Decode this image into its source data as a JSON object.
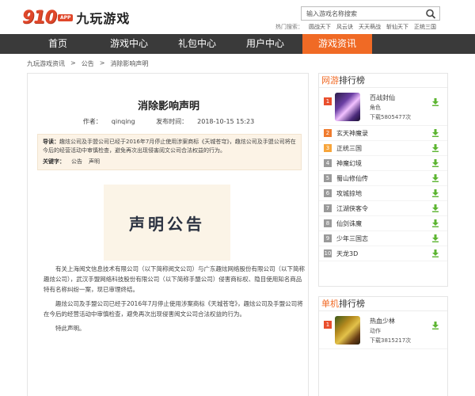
{
  "header": {
    "logo_number": "910",
    "logo_app": "APP",
    "logo_name": "九玩游戏",
    "search_placeholder": "输入游戏名称搜索",
    "hot_label": "热门搜索：",
    "hot_searches": [
      "圆战天下",
      "风云诀",
      "天天萌战",
      "斩仙天下",
      "正统三国"
    ]
  },
  "nav": {
    "items": [
      {
        "label": "首页"
      },
      {
        "label": "游戏中心"
      },
      {
        "label": "礼包中心"
      },
      {
        "label": "用户中心"
      },
      {
        "label": "游戏资讯"
      }
    ],
    "active_index": 4
  },
  "breadcrumb": [
    "九玩游戏资讯",
    ">",
    "公告",
    ">",
    "消除影响声明"
  ],
  "article": {
    "title": "消除影响声明",
    "author_label": "作者：",
    "author": "qinqing",
    "date_label": "发布时间：",
    "date": "2018-10-15 15:23",
    "summary_label": "导读：",
    "summary": "趣炫公司及手盟公司已经于2016年7月停止使用涉案商标《天城苍穹》，趣炫公司及手盟公司将在今后的经营活动中审慎检查，避免再次出现侵害阅文公司合法权益的行为。",
    "keywords_label": "关键字：",
    "keywords": [
      "公告",
      "声明"
    ],
    "stamp_text": "声明公告",
    "paragraphs": [
      "有关上海阅文信息技术有限公司（以下简称阅文公司）与广东趣炫网络股份有限公司（以下简称趣炫公司），武汉手盟网络科技股份有限公司（以下简称手盟公司）侵害商标权、隐目使用知名商品特有名称纠纷一案，现已审理终结。",
      "趣炫公司及手盟公司已经于2016年7月停止使用涉案商标《天城苍穹》，趣炫公司及手盟公司将在今后的经营活动中审慎检查，避免再次出现侵害阅文公司合法权益的行为。",
      "特此声明。"
    ]
  },
  "sidebar": {
    "online": {
      "title_a": "网游",
      "title_b": "排行榜",
      "featured": {
        "rank": "1",
        "name": "百战封仙",
        "genre": "角色",
        "downloads": "下载5805477次"
      },
      "items": [
        {
          "rank": "2",
          "name": "玄天神魔录"
        },
        {
          "rank": "3",
          "name": "正统三国"
        },
        {
          "rank": "4",
          "name": "神魔幻境"
        },
        {
          "rank": "5",
          "name": "蜀山修仙传"
        },
        {
          "rank": "6",
          "name": "攻城掠地"
        },
        {
          "rank": "7",
          "name": "江湖侠客令"
        },
        {
          "rank": "8",
          "name": "仙剑诛魔"
        },
        {
          "rank": "9",
          "name": "少年三国志"
        },
        {
          "rank": "10",
          "name": "天龙3D"
        }
      ]
    },
    "single": {
      "title_a": "单机",
      "title_b": "排行榜",
      "featured": {
        "rank": "1",
        "name": "热血少林",
        "genre": "动作",
        "downloads": "下载3815217次"
      }
    }
  },
  "colors": {
    "brand_orange": "#f06a25",
    "nav_bg": "#3a3a3a",
    "download_green": "#5cb531"
  }
}
